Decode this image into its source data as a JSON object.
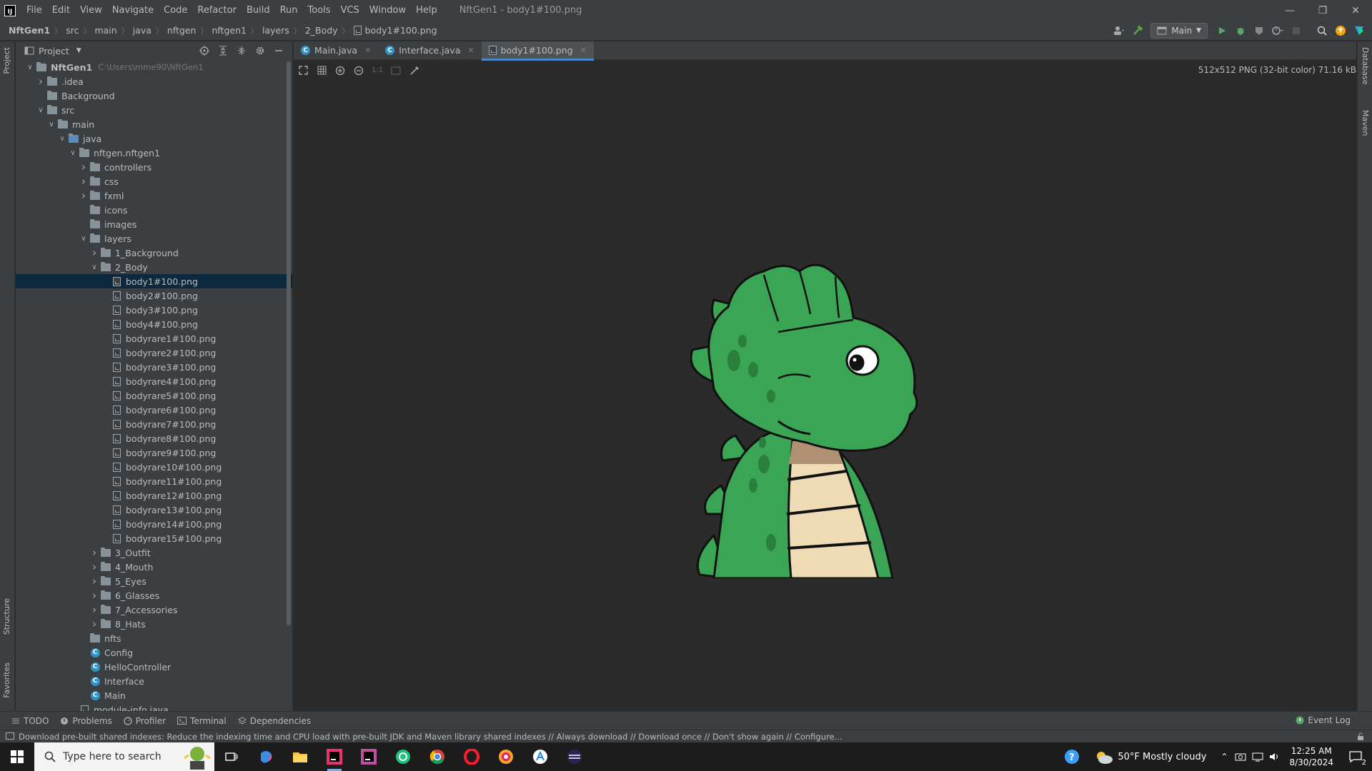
{
  "titlebar": {
    "menu": [
      "File",
      "Edit",
      "View",
      "Navigate",
      "Code",
      "Refactor",
      "Build",
      "Run",
      "Tools",
      "VCS",
      "Window",
      "Help"
    ],
    "window_title": "NftGen1 - body1#100.png",
    "logo": "IJ"
  },
  "breadcrumb": [
    "NftGen1",
    "src",
    "main",
    "java",
    "nftgen",
    "nftgen1",
    "layers",
    "2_Body",
    "body1#100.png"
  ],
  "run_config": "Main",
  "project_panel": {
    "title": "Project",
    "tree": [
      {
        "label": "NftGen1",
        "path": "C:\\Users\\mme90\\NftGen1",
        "depth": 0,
        "arrow": "open",
        "icon": "module",
        "bold": true
      },
      {
        "label": ".idea",
        "depth": 1,
        "arrow": "closed",
        "icon": "folder"
      },
      {
        "label": "Background",
        "depth": 1,
        "arrow": "none",
        "icon": "folder"
      },
      {
        "label": "src",
        "depth": 1,
        "arrow": "open",
        "icon": "folder"
      },
      {
        "label": "main",
        "depth": 2,
        "arrow": "open",
        "icon": "folder"
      },
      {
        "label": "java",
        "depth": 3,
        "arrow": "open",
        "icon": "folder-blue"
      },
      {
        "label": "nftgen.nftgen1",
        "depth": 4,
        "arrow": "open",
        "icon": "folder"
      },
      {
        "label": "controllers",
        "depth": 5,
        "arrow": "closed",
        "icon": "folder"
      },
      {
        "label": "css",
        "depth": 5,
        "arrow": "closed",
        "icon": "folder"
      },
      {
        "label": "fxml",
        "depth": 5,
        "arrow": "closed",
        "icon": "folder"
      },
      {
        "label": "icons",
        "depth": 5,
        "arrow": "none",
        "icon": "folder"
      },
      {
        "label": "images",
        "depth": 5,
        "arrow": "none",
        "icon": "folder"
      },
      {
        "label": "layers",
        "depth": 5,
        "arrow": "open",
        "icon": "folder"
      },
      {
        "label": "1_Background",
        "depth": 6,
        "arrow": "closed",
        "icon": "folder"
      },
      {
        "label": "2_Body",
        "depth": 6,
        "arrow": "open",
        "icon": "folder"
      },
      {
        "label": "body1#100.png",
        "depth": 7,
        "arrow": "none",
        "icon": "image",
        "selected": true
      },
      {
        "label": "body2#100.png",
        "depth": 7,
        "arrow": "none",
        "icon": "image"
      },
      {
        "label": "body3#100.png",
        "depth": 7,
        "arrow": "none",
        "icon": "image"
      },
      {
        "label": "body4#100.png",
        "depth": 7,
        "arrow": "none",
        "icon": "image"
      },
      {
        "label": "bodyrare1#100.png",
        "depth": 7,
        "arrow": "none",
        "icon": "image"
      },
      {
        "label": "bodyrare2#100.png",
        "depth": 7,
        "arrow": "none",
        "icon": "image"
      },
      {
        "label": "bodyrare3#100.png",
        "depth": 7,
        "arrow": "none",
        "icon": "image"
      },
      {
        "label": "bodyrare4#100.png",
        "depth": 7,
        "arrow": "none",
        "icon": "image"
      },
      {
        "label": "bodyrare5#100.png",
        "depth": 7,
        "arrow": "none",
        "icon": "image"
      },
      {
        "label": "bodyrare6#100.png",
        "depth": 7,
        "arrow": "none",
        "icon": "image"
      },
      {
        "label": "bodyrare7#100.png",
        "depth": 7,
        "arrow": "none",
        "icon": "image"
      },
      {
        "label": "bodyrare8#100.png",
        "depth": 7,
        "arrow": "none",
        "icon": "image"
      },
      {
        "label": "bodyrare9#100.png",
        "depth": 7,
        "arrow": "none",
        "icon": "image"
      },
      {
        "label": "bodyrare10#100.png",
        "depth": 7,
        "arrow": "none",
        "icon": "image"
      },
      {
        "label": "bodyrare11#100.png",
        "depth": 7,
        "arrow": "none",
        "icon": "image"
      },
      {
        "label": "bodyrare12#100.png",
        "depth": 7,
        "arrow": "none",
        "icon": "image"
      },
      {
        "label": "bodyrare13#100.png",
        "depth": 7,
        "arrow": "none",
        "icon": "image"
      },
      {
        "label": "bodyrare14#100.png",
        "depth": 7,
        "arrow": "none",
        "icon": "image"
      },
      {
        "label": "bodyrare15#100.png",
        "depth": 7,
        "arrow": "none",
        "icon": "image"
      },
      {
        "label": "3_Outfit",
        "depth": 6,
        "arrow": "closed",
        "icon": "folder"
      },
      {
        "label": "4_Mouth",
        "depth": 6,
        "arrow": "closed",
        "icon": "folder"
      },
      {
        "label": "5_Eyes",
        "depth": 6,
        "arrow": "closed",
        "icon": "folder"
      },
      {
        "label": "6_Glasses",
        "depth": 6,
        "arrow": "closed",
        "icon": "folder"
      },
      {
        "label": "7_Accessories",
        "depth": 6,
        "arrow": "closed",
        "icon": "folder"
      },
      {
        "label": "8_Hats",
        "depth": 6,
        "arrow": "closed",
        "icon": "folder"
      },
      {
        "label": "nfts",
        "depth": 5,
        "arrow": "none",
        "icon": "folder"
      },
      {
        "label": "Config",
        "depth": 5,
        "arrow": "none",
        "icon": "class"
      },
      {
        "label": "HelloController",
        "depth": 5,
        "arrow": "none",
        "icon": "class"
      },
      {
        "label": "Interface",
        "depth": 5,
        "arrow": "none",
        "icon": "class"
      },
      {
        "label": "Main",
        "depth": 5,
        "arrow": "none",
        "icon": "class"
      },
      {
        "label": "module-info.java",
        "depth": 4,
        "arrow": "none",
        "icon": "java"
      }
    ]
  },
  "left_strip": [
    "Project",
    "Structure",
    "Favorites"
  ],
  "right_strip": [
    "Database",
    "Maven"
  ],
  "tabs": [
    {
      "label": "Main.java",
      "icon": "class",
      "active": false
    },
    {
      "label": "Interface.java",
      "icon": "class",
      "active": false
    },
    {
      "label": "body1#100.png",
      "icon": "image",
      "active": true
    }
  ],
  "image_info": "512x512 PNG (32-bit color) 71.16 kB",
  "image_tools": {
    "actual_size": "1:1"
  },
  "bottom_tools": [
    "TODO",
    "Problems",
    "Profiler",
    "Terminal",
    "Dependencies"
  ],
  "event_log": "Event Log",
  "status_message": "Download pre-built shared indexes: Reduce the indexing time and CPU load with pre-built JDK and Maven library shared indexes // Always download // Download once // Don't show again // Configure...",
  "taskbar": {
    "search_placeholder": "Type here to search",
    "weather": "50°F  Mostly cloudy",
    "time": "12:25 AM",
    "date": "8/30/2024",
    "notifications": "2"
  },
  "colors": {
    "selected_row": "#0d293e",
    "accent": "#4a88c7",
    "dino_green": "#3aa655",
    "dino_belly": "#f0dcb4"
  }
}
